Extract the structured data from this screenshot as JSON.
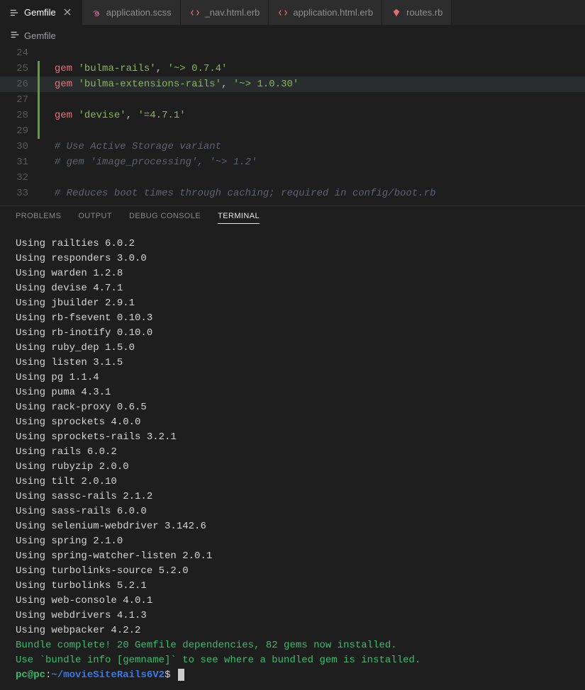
{
  "tabs": [
    {
      "label": "Gemfile",
      "icon": "gemfile",
      "active": true,
      "closable": true
    },
    {
      "label": "application.scss",
      "icon": "sass",
      "active": false
    },
    {
      "label": "_nav.html.erb",
      "icon": "erb",
      "active": false
    },
    {
      "label": "application.html.erb",
      "icon": "erb",
      "active": false
    },
    {
      "label": "routes.rb",
      "icon": "rb",
      "active": false
    }
  ],
  "breadcrumb": {
    "icon": "gemfile",
    "label": "Gemfile"
  },
  "editor": {
    "lines": {
      "l24": "24",
      "l25": "25",
      "l26": "26",
      "l27": "27",
      "l28": "28",
      "l29": "29",
      "l30": "30",
      "l31": "31",
      "l32": "32",
      "l33": "33"
    },
    "tokens": {
      "gem_kw": "gem",
      "bulma_rails": "'bulma-rails'",
      "bulma_rails_ver": "'~> 0.7.4'",
      "bulma_ext": "'bulma-extensions-rails'",
      "bulma_ext_ver": "'~> 1.0.30'",
      "devise": "'devise'",
      "devise_ver": "'=4.7.1'",
      "comma": ", ",
      "comment_storage": "# Use Active Storage variant",
      "comment_image": "# gem 'image_processing', '~> 1.2'",
      "comment_boot": "# Reduces boot times through caching; required in config/boot.rb"
    }
  },
  "panel_tabs": {
    "problems": "PROBLEMS",
    "output": "OUTPUT",
    "debug_console": "DEBUG CONSOLE",
    "terminal": "TERMINAL"
  },
  "terminal": {
    "lines": [
      "Using railties 6.0.2",
      "Using responders 3.0.0",
      "Using warden 1.2.8",
      "Using devise 4.7.1",
      "Using jbuilder 2.9.1",
      "Using rb-fsevent 0.10.3",
      "Using rb-inotify 0.10.0",
      "Using ruby_dep 1.5.0",
      "Using listen 3.1.5",
      "Using pg 1.1.4",
      "Using puma 4.3.1",
      "Using rack-proxy 0.6.5",
      "Using sprockets 4.0.0",
      "Using sprockets-rails 3.2.1",
      "Using rails 6.0.2",
      "Using rubyzip 2.0.0",
      "Using tilt 2.0.10",
      "Using sassc-rails 2.1.2",
      "Using sass-rails 6.0.0",
      "Using selenium-webdriver 3.142.6",
      "Using spring 2.1.0",
      "Using spring-watcher-listen 2.0.1",
      "Using turbolinks-source 5.2.0",
      "Using turbolinks 5.2.1",
      "Using web-console 4.0.1",
      "Using webdrivers 4.1.3",
      "Using webpacker 4.2.2"
    ],
    "complete1": "Bundle complete! 20 Gemfile dependencies, 82 gems now installed.",
    "complete2": "Use `bundle info [gemname]` to see where a bundled gem is installed.",
    "prompt": {
      "user_host": "pc@pc",
      "colon": ":",
      "path": "~/movieSiteRails6V2",
      "dollar": "$ "
    }
  }
}
